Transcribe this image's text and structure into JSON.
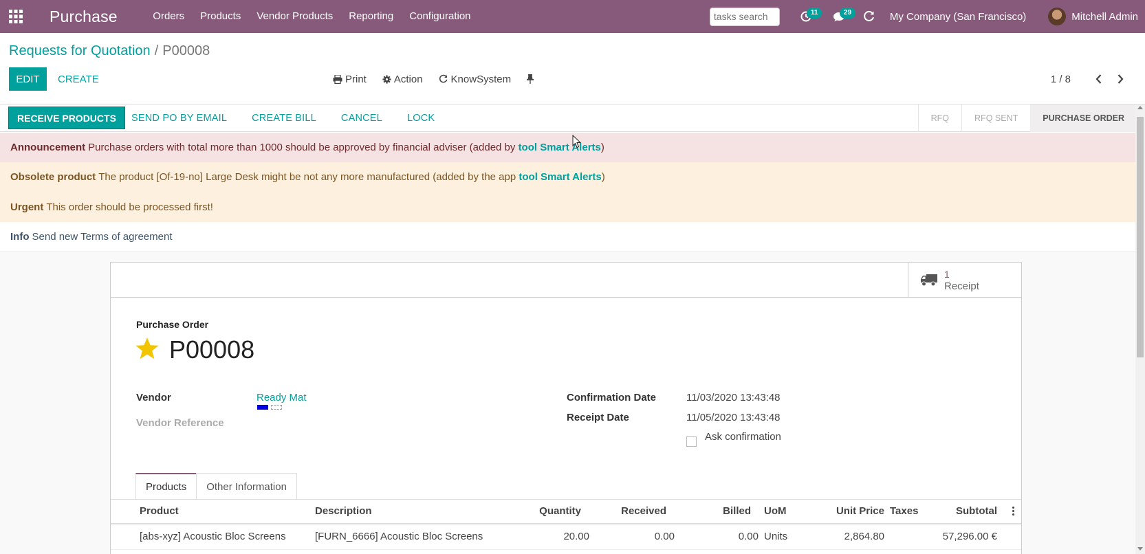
{
  "navbar": {
    "app_title": "Purchase",
    "menu": [
      "Orders",
      "Products",
      "Vendor Products",
      "Reporting",
      "Configuration"
    ],
    "search_placeholder": "tasks search",
    "activity_count": "11",
    "messages_count": "29",
    "company": "My Company (San Francisco)",
    "user": "Mitchell Admin",
    "brand_color": "#875a7b"
  },
  "breadcrumb": {
    "parent": "Requests for Quotation",
    "separator": "/",
    "current": "P00008"
  },
  "buttons": {
    "edit": "EDIT",
    "create": "CREATE",
    "print": "Print",
    "action": "Action",
    "knowsystem": "KnowSystem"
  },
  "pager": {
    "value": "1 / 8"
  },
  "statusbar": {
    "primary": "RECEIVE PRODUCTS",
    "actions": [
      "SEND PO BY EMAIL",
      "CREATE BILL",
      "CANCEL",
      "LOCK"
    ],
    "stages": [
      "RFQ",
      "RFQ SENT",
      "PURCHASE ORDER"
    ],
    "active_stage": "PURCHASE ORDER"
  },
  "alerts": {
    "announcement": {
      "title": "Announcement",
      "text": "Purchase orders with total more than 1000 should be approved by financial adviser (added by",
      "link": "tool Smart Alerts",
      "tail": ")"
    },
    "obsolete": {
      "title": "Obsolete product",
      "text": "The product [Of-19-no] Large Desk might be not any more manufactured (added by the app",
      "link": "tool Smart Alerts",
      "tail": ")"
    },
    "urgent": {
      "title": "Urgent",
      "text": "This order should be processed first!"
    },
    "info": {
      "title": "Info",
      "text": "Send new Terms of agreement"
    }
  },
  "stat_button": {
    "value": "1",
    "label": "Receipt"
  },
  "form": {
    "doc_label": "Purchase Order",
    "name": "P00008",
    "vendor_label": "Vendor",
    "vendor_value": "Ready Mat",
    "vendor_ref_label": "Vendor Reference",
    "confirmation_label": "Confirmation Date",
    "confirmation_value": "11/03/2020 13:43:48",
    "receipt_label": "Receipt Date",
    "receipt_value": "11/05/2020 13:43:48",
    "ask_confirmation": "Ask confirmation"
  },
  "tabs": [
    "Products",
    "Other Information"
  ],
  "lines": {
    "headers": [
      "Product",
      "Description",
      "Quantity",
      "Received",
      "Billed",
      "UoM",
      "Unit Price",
      "Taxes",
      "Subtotal"
    ],
    "rows": [
      [
        "[abs-xyz] Acoustic Bloc Screens",
        "[FURN_6666] Acoustic Bloc Screens",
        "20.00",
        "0.00",
        "0.00",
        "Units",
        "2,864.80",
        "",
        "57,296.00 €"
      ]
    ]
  }
}
